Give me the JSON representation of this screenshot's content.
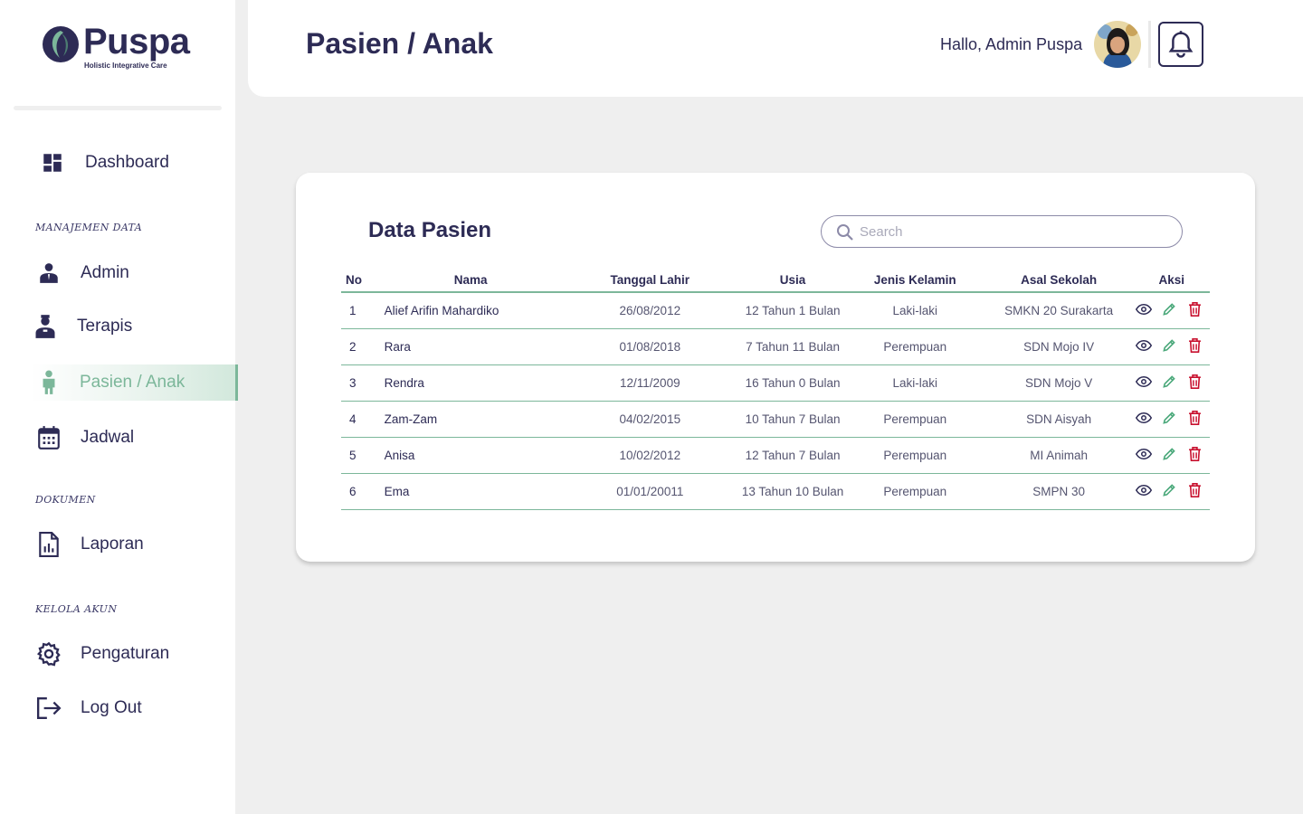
{
  "brand": {
    "name": "Puspa",
    "tagline": "Holistic Integrative Care"
  },
  "colors": {
    "primary": "#2d2b55",
    "accent": "#7cb79a",
    "danger": "#c8102e",
    "background": "#efefef"
  },
  "sidebar": {
    "dashboard": {
      "label": "Dashboard",
      "icon": "dashboard-icon"
    },
    "sections": {
      "manajemen": "MANAJEMEN DATA",
      "dokumen": "DOKUMEN",
      "kelola": "KELOLA AKUN"
    },
    "items": {
      "admin": {
        "label": "Admin",
        "icon": "admin-icon"
      },
      "terapis": {
        "label": "Terapis",
        "icon": "therapist-icon"
      },
      "pasien": {
        "label": "Pasien / Anak",
        "icon": "child-icon",
        "active": true
      },
      "jadwal": {
        "label": "Jadwal",
        "icon": "calendar-icon"
      },
      "laporan": {
        "label": "Laporan",
        "icon": "report-icon"
      },
      "pengaturan": {
        "label": "Pengaturan",
        "icon": "gear-icon"
      },
      "logout": {
        "label": "Log Out",
        "icon": "logout-icon"
      }
    }
  },
  "header": {
    "title": "Pasien / Anak",
    "greeting": "Hallo, Admin Puspa",
    "notification_icon": "bell-icon"
  },
  "main": {
    "card_title": "Data Pasien",
    "search": {
      "placeholder": "Search",
      "value": ""
    },
    "table": {
      "headers": {
        "no": "No",
        "nama": "Nama",
        "tanggal_lahir": "Tanggal Lahir",
        "usia": "Usia",
        "jenis_kelamin": "Jenis Kelamin",
        "asal_sekolah": "Asal Sekolah",
        "aksi": "Aksi"
      },
      "rows": [
        {
          "no": "1",
          "nama": "Alief Arifin Mahardiko",
          "tanggal_lahir": "26/08/2012",
          "usia": "12 Tahun 1 Bulan",
          "jenis_kelamin": "Laki-laki",
          "asal_sekolah": "SMKN 20 Surakarta"
        },
        {
          "no": "2",
          "nama": "Rara",
          "tanggal_lahir": "01/08/2018",
          "usia": "7 Tahun 11 Bulan",
          "jenis_kelamin": "Perempuan",
          "asal_sekolah": "SDN Mojo IV"
        },
        {
          "no": "3",
          "nama": "Rendra",
          "tanggal_lahir": "12/11/2009",
          "usia": "16 Tahun 0 Bulan",
          "jenis_kelamin": "Laki-laki",
          "asal_sekolah": "SDN Mojo V"
        },
        {
          "no": "4",
          "nama": "Zam-Zam",
          "tanggal_lahir": "04/02/2015",
          "usia": "10 Tahun 7 Bulan",
          "jenis_kelamin": "Perempuan",
          "asal_sekolah": "SDN Aisyah"
        },
        {
          "no": "5",
          "nama": "Anisa",
          "tanggal_lahir": "10/02/2012",
          "usia": "12 Tahun 7 Bulan",
          "jenis_kelamin": "Perempuan",
          "asal_sekolah": "MI Animah"
        },
        {
          "no": "6",
          "nama": "Ema",
          "tanggal_lahir": "01/01/20011",
          "usia": "13 Tahun 10 Bulan",
          "jenis_kelamin": "Perempuan",
          "asal_sekolah": "SMPN 30"
        }
      ],
      "action_icons": [
        "eye-icon",
        "pencil-icon",
        "trash-icon"
      ]
    }
  }
}
